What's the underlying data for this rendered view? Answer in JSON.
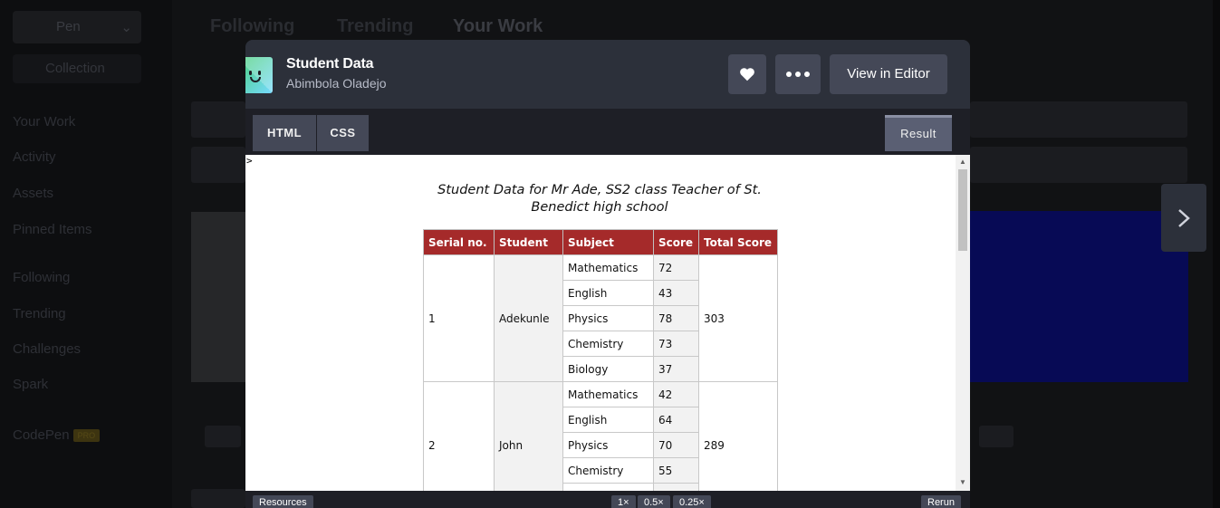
{
  "background": {
    "sidebar": {
      "pen_label": "Pen",
      "collection_label": "Collection",
      "nav_items": [
        "Your Work",
        "Activity",
        "Assets",
        "Pinned Items",
        "Following",
        "Trending",
        "Challenges",
        "Spark",
        "CodePen"
      ],
      "pro_badge": "PRO"
    },
    "tabs": [
      "Following",
      "Trending",
      "Your Work"
    ]
  },
  "modal": {
    "title": "Student Data",
    "author": "Abimbola Oladejo",
    "view_in_editor_label": "View in Editor",
    "tabs": {
      "html": "HTML",
      "css": "CSS",
      "result": "Result"
    },
    "footer": {
      "resources_label": "Resources",
      "zoom_options": [
        "1×",
        "0.5×",
        "0.25×"
      ],
      "rerun_label": "Rerun"
    }
  },
  "result": {
    "stray_text": ">",
    "caption_line1": "Student Data for Mr Ade, SS2 class Teacher of St.",
    "caption_line2": "Benedict high school",
    "headers": [
      "Serial no.",
      "Student",
      "Subject",
      "Score",
      "Total Score"
    ],
    "students": [
      {
        "serial": "1",
        "name": "Adekunle",
        "total": "303",
        "subjects": [
          {
            "subject": "Mathematics",
            "score": "72"
          },
          {
            "subject": "English",
            "score": "43"
          },
          {
            "subject": "Physics",
            "score": "78"
          },
          {
            "subject": "Chemistry",
            "score": "73"
          },
          {
            "subject": "Biology",
            "score": "37"
          }
        ]
      },
      {
        "serial": "2",
        "name": "John",
        "total": "289",
        "subjects": [
          {
            "subject": "Mathematics",
            "score": "42"
          },
          {
            "subject": "English",
            "score": "64"
          },
          {
            "subject": "Physics",
            "score": "70"
          },
          {
            "subject": "Chemistry",
            "score": "55"
          },
          {
            "subject": "",
            "score": ""
          }
        ]
      }
    ]
  },
  "colors": {
    "table_header": "#a52a2a",
    "modal_header": "#2c303a",
    "button": "#444857"
  },
  "icons": {
    "like": "heart-icon",
    "more": "more-dots-icon",
    "next": "chevron-right-icon",
    "logo": "codepen-pen-logo-icon"
  }
}
